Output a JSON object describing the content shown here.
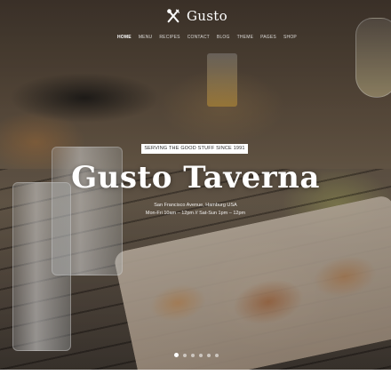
{
  "brand": {
    "name": "Gusto",
    "icon": "fork-knife-icon"
  },
  "nav": {
    "items": [
      {
        "label": "HOME",
        "active": true
      },
      {
        "label": "MENU",
        "active": false
      },
      {
        "label": "RECIPES",
        "active": false
      },
      {
        "label": "CONTACT",
        "active": false
      },
      {
        "label": "BLOG",
        "active": false
      },
      {
        "label": "THEME",
        "active": false
      },
      {
        "label": "PAGES",
        "active": false
      },
      {
        "label": "SHOP",
        "active": false
      }
    ]
  },
  "hero": {
    "tagline": "SERVING THE GOOD STUFF SINCE 1991",
    "title": "Gusto Taverna",
    "address": "San Francisco Avenue, Hamburg USA",
    "hours": "Mon-Fri 10am – 12pm // Sat-Sun 1pm – 12pm"
  },
  "slider": {
    "count": 6,
    "active_index": 0
  },
  "colors": {
    "text": "#ffffff",
    "tagline_bg": "#ffffff",
    "tagline_text": "#2a2a2a"
  }
}
